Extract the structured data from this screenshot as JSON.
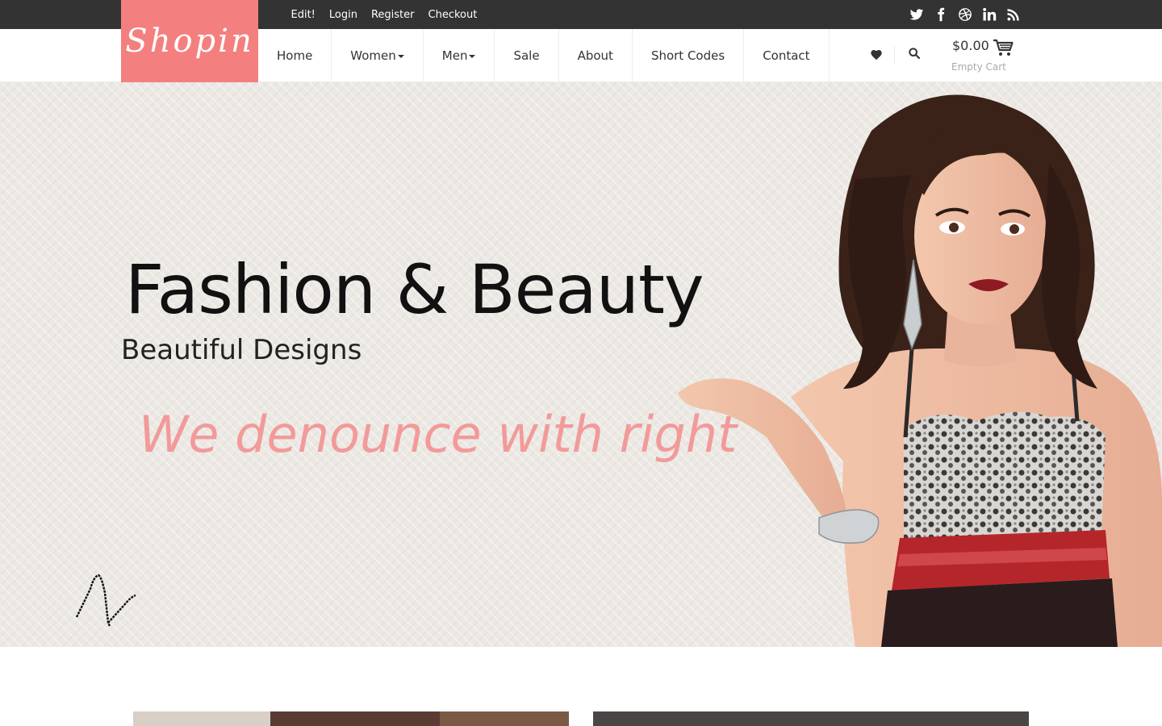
{
  "topbar": {
    "links": [
      {
        "label": "Edit!"
      },
      {
        "label": "Login"
      },
      {
        "label": "Register"
      },
      {
        "label": "Checkout"
      }
    ],
    "social": [
      "twitter-icon",
      "facebook-icon",
      "dribbble-icon",
      "linkedin-icon",
      "rss-icon"
    ]
  },
  "logo": {
    "text": "Shopin"
  },
  "nav": {
    "items": [
      {
        "label": "Home"
      },
      {
        "label": "Women",
        "dropdown": true
      },
      {
        "label": "Men",
        "dropdown": true
      },
      {
        "label": "Sale"
      },
      {
        "label": "About"
      },
      {
        "label": "Short Codes"
      },
      {
        "label": "Contact"
      }
    ]
  },
  "cart": {
    "amount": "$0.00",
    "label": "Empty Cart"
  },
  "hero": {
    "title": "Fashion & Beauty",
    "subtitle": "Beautiful Designs",
    "tagline": "We denounce with right"
  },
  "colors": {
    "brand": "#f47f7f",
    "topbar": "#333333",
    "tagline": "#f29a9a"
  }
}
